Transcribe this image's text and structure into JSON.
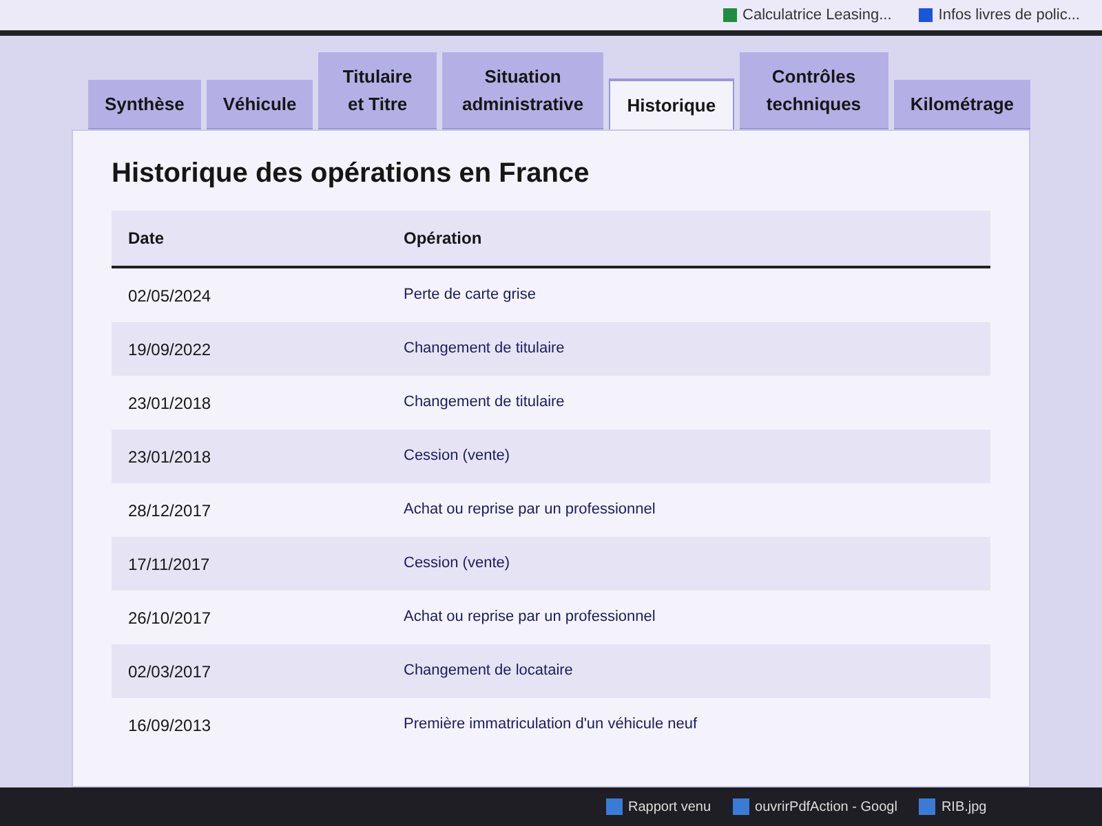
{
  "bookmarks": [
    {
      "label": "Calculatrice Leasing...",
      "color": "#1e8e3e"
    },
    {
      "label": "Infos livres de polic...",
      "color": "#1a56db"
    }
  ],
  "tabs": [
    {
      "label": "Synthèse",
      "selected": false
    },
    {
      "label": "Véhicule",
      "selected": false
    },
    {
      "label": "Titulaire et Titre",
      "selected": false
    },
    {
      "label": "Situation administrative",
      "selected": false
    },
    {
      "label": "Historique",
      "selected": true
    },
    {
      "label": "Contrôles techniques",
      "selected": false
    },
    {
      "label": "Kilométrage",
      "selected": false
    }
  ],
  "title": "Historique des opérations en France",
  "table": {
    "columns": [
      "Date",
      "Opération"
    ],
    "rows": [
      [
        "02/05/2024",
        "Perte de carte grise"
      ],
      [
        "19/09/2022",
        "Changement de titulaire"
      ],
      [
        "23/01/2018",
        "Changement de titulaire"
      ],
      [
        "23/01/2018",
        "Cession (vente)"
      ],
      [
        "28/12/2017",
        "Achat ou reprise par un professionnel"
      ],
      [
        "17/11/2017",
        "Cession (vente)"
      ],
      [
        "26/10/2017",
        "Achat ou reprise par un professionnel"
      ],
      [
        "02/03/2017",
        "Changement de locataire"
      ],
      [
        "16/09/2013",
        "Première immatriculation d'un véhicule neuf"
      ]
    ]
  },
  "taskbar": [
    {
      "label": "Rapport venu"
    },
    {
      "label": "ouvrirPdfAction - Googl"
    },
    {
      "label": "RIB.jpg"
    }
  ]
}
